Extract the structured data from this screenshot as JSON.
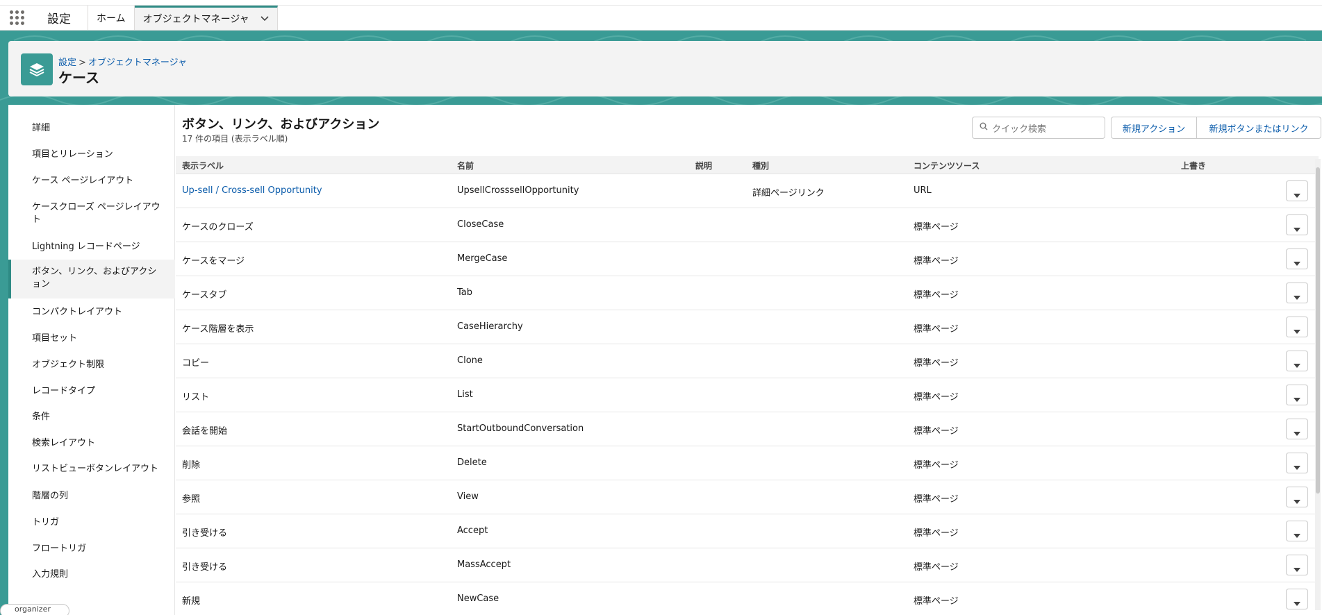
{
  "app": {
    "name": "設定",
    "tabs": [
      {
        "label": "ホーム"
      },
      {
        "label": "オブジェクトマネージャ"
      }
    ]
  },
  "header": {
    "breadcrumb": [
      "設定",
      "オブジェクトマネージャ"
    ],
    "breadcrumb_sep": ">",
    "title": "ケース"
  },
  "sidebar": {
    "items": [
      {
        "label": "詳細"
      },
      {
        "label": "項目とリレーション"
      },
      {
        "label": "ケース ページレイアウト"
      },
      {
        "label": "ケースクローズ ページレイアウト"
      },
      {
        "label": "Lightning レコードページ"
      },
      {
        "label": "ボタン、リンク、およびアクション"
      },
      {
        "label": "コンパクトレイアウト"
      },
      {
        "label": "項目セット"
      },
      {
        "label": "オブジェクト制限"
      },
      {
        "label": "レコードタイプ"
      },
      {
        "label": "条件"
      },
      {
        "label": "検索レイアウト"
      },
      {
        "label": "リストビューボタンレイアウト"
      },
      {
        "label": "階層の列"
      },
      {
        "label": "トリガ"
      },
      {
        "label": "フロートリガ"
      },
      {
        "label": "入力規則"
      }
    ],
    "active_index": 5
  },
  "content": {
    "title": "ボタン、リンク、およびアクション",
    "subtitle": "17 件の項目 (表示ラベル順)",
    "search_placeholder": "クイック検索",
    "new_action_button": "新規アクション",
    "new_button_link": "新規ボタンまたはリンク"
  },
  "table": {
    "columns": [
      "表示ラベル",
      "名前",
      "説明",
      "種別",
      "コンテンツソース",
      "上書き"
    ],
    "rows": [
      {
        "label": "Up-sell / Cross-sell Opportunity",
        "name": "UpsellCrosssellOpportunity",
        "desc": "",
        "type": "詳細ページリンク",
        "source": "URL",
        "override": "",
        "is_link": true
      },
      {
        "label": "ケースのクローズ",
        "name": "CloseCase",
        "desc": "",
        "type": "",
        "source": "標準ページ",
        "override": "",
        "is_link": false
      },
      {
        "label": "ケースをマージ",
        "name": "MergeCase",
        "desc": "",
        "type": "",
        "source": "標準ページ",
        "override": "",
        "is_link": false
      },
      {
        "label": "ケースタブ",
        "name": "Tab",
        "desc": "",
        "type": "",
        "source": "標準ページ",
        "override": "",
        "is_link": false
      },
      {
        "label": "ケース階層を表示",
        "name": "CaseHierarchy",
        "desc": "",
        "type": "",
        "source": "標準ページ",
        "override": "",
        "is_link": false
      },
      {
        "label": "コピー",
        "name": "Clone",
        "desc": "",
        "type": "",
        "source": "標準ページ",
        "override": "",
        "is_link": false
      },
      {
        "label": "リスト",
        "name": "List",
        "desc": "",
        "type": "",
        "source": "標準ページ",
        "override": "",
        "is_link": false
      },
      {
        "label": "会話を開始",
        "name": "StartOutboundConversation",
        "desc": "",
        "type": "",
        "source": "標準ページ",
        "override": "",
        "is_link": false
      },
      {
        "label": "削除",
        "name": "Delete",
        "desc": "",
        "type": "",
        "source": "標準ページ",
        "override": "",
        "is_link": false
      },
      {
        "label": "参照",
        "name": "View",
        "desc": "",
        "type": "",
        "source": "標準ページ",
        "override": "",
        "is_link": false
      },
      {
        "label": "引き受ける",
        "name": "Accept",
        "desc": "",
        "type": "",
        "source": "標準ページ",
        "override": "",
        "is_link": false
      },
      {
        "label": "引き受ける",
        "name": "MassAccept",
        "desc": "",
        "type": "",
        "source": "標準ページ",
        "override": "",
        "is_link": false
      },
      {
        "label": "新規",
        "name": "NewCase",
        "desc": "",
        "type": "",
        "source": "標準ページ",
        "override": "",
        "is_link": false
      }
    ]
  },
  "footer": {
    "organizer_label": "organizer"
  },
  "colors": {
    "brand_teal": "#3a9b95",
    "link_blue": "#0b5cab",
    "header_bg": "#f3f3f3"
  }
}
